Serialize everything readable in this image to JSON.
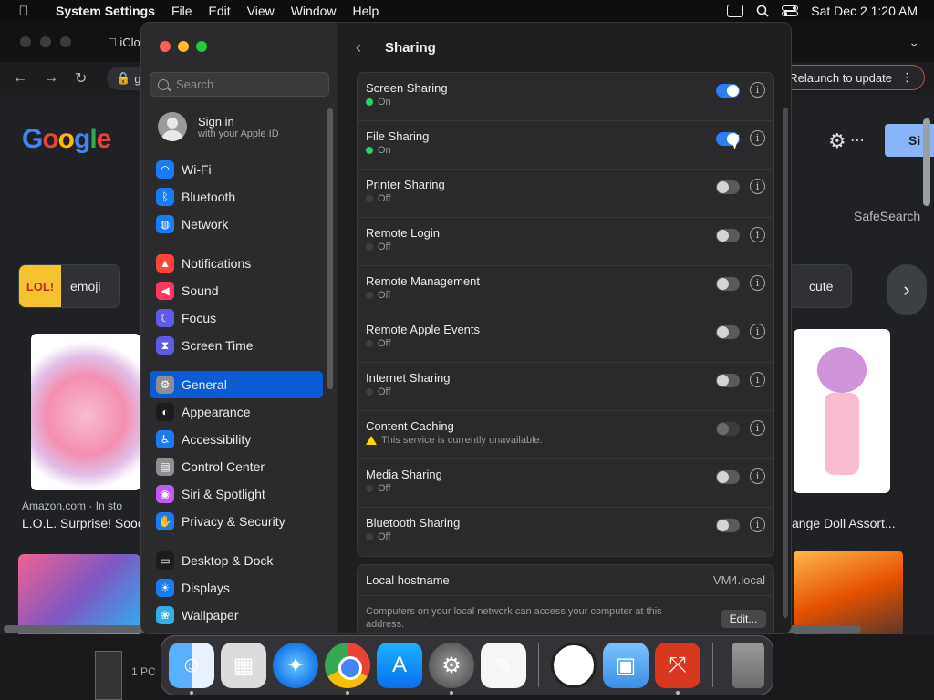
{
  "menubar": {
    "app_name": "System Settings",
    "menus": [
      "File",
      "Edit",
      "View",
      "Window",
      "Help"
    ],
    "datetime": "Sat Dec 2  1:20 AM"
  },
  "browser": {
    "tab_title": "iClou",
    "url_fragment": "g",
    "relaunch_label": "Relaunch to update",
    "logo": "Google",
    "signin": "Si",
    "safesearch": "SafeSearch",
    "chips": [
      "emoji",
      "cute"
    ],
    "chip_thumb": "LOL!",
    "result_source": "Amazon.com · In sto",
    "result_title": "L.O.L. Surprise! Sooo",
    "result_title_right": "ange Doll Assort...",
    "taskbar_label": "1 PC"
  },
  "settings": {
    "search_placeholder": "Search",
    "apple_id": {
      "title": "Sign in",
      "subtitle": "with your Apple ID"
    },
    "sidebar": [
      {
        "label": "Wi-Fi",
        "icon": "wifi-icon",
        "glyph": "◠",
        "color": "#1a7cf5"
      },
      {
        "label": "Bluetooth",
        "icon": "bluetooth-icon",
        "glyph": "ᛒ",
        "color": "#1a7cf5"
      },
      {
        "label": "Network",
        "icon": "globe-icon",
        "glyph": "◍",
        "color": "#1a7cf5"
      },
      {
        "label": "Notifications",
        "icon": "bell-icon",
        "glyph": "▲",
        "color": "#ff453a"
      },
      {
        "label": "Sound",
        "icon": "speaker-icon",
        "glyph": "◀",
        "color": "#ff375f"
      },
      {
        "label": "Focus",
        "icon": "moon-icon",
        "glyph": "☾",
        "color": "#5e5ce6"
      },
      {
        "label": "Screen Time",
        "icon": "hourglass-icon",
        "glyph": "⧗",
        "color": "#5e5ce6"
      },
      {
        "label": "General",
        "icon": "gear-icon",
        "glyph": "⚙",
        "color": "#8e8e93"
      },
      {
        "label": "Appearance",
        "icon": "appearance-icon",
        "glyph": "◐",
        "color": "#1c1c1e"
      },
      {
        "label": "Accessibility",
        "icon": "accessibility-icon",
        "glyph": "♿",
        "color": "#1a7cf5"
      },
      {
        "label": "Control Center",
        "icon": "control-center-icon",
        "glyph": "▤",
        "color": "#8e8e93"
      },
      {
        "label": "Siri & Spotlight",
        "icon": "siri-icon",
        "glyph": "◉",
        "color": "#bf5af2"
      },
      {
        "label": "Privacy & Security",
        "icon": "hand-icon",
        "glyph": "✋",
        "color": "#1a7cf5"
      },
      {
        "label": "Desktop & Dock",
        "icon": "dock-icon",
        "glyph": "▭",
        "color": "#1c1c1e"
      },
      {
        "label": "Displays",
        "icon": "display-icon",
        "glyph": "☀",
        "color": "#1a7cf5"
      },
      {
        "label": "Wallpaper",
        "icon": "wallpaper-icon",
        "glyph": "❀",
        "color": "#32ade6"
      }
    ],
    "active_item": "General",
    "pane_title": "Sharing",
    "services": [
      {
        "name": "Screen Sharing",
        "status": "On",
        "state": "on"
      },
      {
        "name": "File Sharing",
        "status": "On",
        "state": "on"
      },
      {
        "name": "Printer Sharing",
        "status": "Off",
        "state": "off"
      },
      {
        "name": "Remote Login",
        "status": "Off",
        "state": "off"
      },
      {
        "name": "Remote Management",
        "status": "Off",
        "state": "off"
      },
      {
        "name": "Remote Apple Events",
        "status": "Off",
        "state": "off"
      },
      {
        "name": "Internet Sharing",
        "status": "Off",
        "state": "off"
      },
      {
        "name": "Content Caching",
        "status": "This service is currently unavailable.",
        "state": "disabled"
      },
      {
        "name": "Media Sharing",
        "status": "Off",
        "state": "off"
      },
      {
        "name": "Bluetooth Sharing",
        "status": "Off",
        "state": "off"
      }
    ],
    "hostname_label": "Local hostname",
    "hostname_value": "VM4.local",
    "hostname_note": "Computers on your local network can access your computer at this address.",
    "edit_label": "Edit..."
  },
  "dock": [
    {
      "name": "finder-app",
      "cls": "finder",
      "glyph": "☺",
      "running": true
    },
    {
      "name": "launchpad-app",
      "cls": "launchpad",
      "glyph": "▦",
      "running": false
    },
    {
      "name": "safari-app",
      "cls": "safari",
      "glyph": "✦",
      "running": false
    },
    {
      "name": "chrome-app",
      "cls": "chrome",
      "glyph": "",
      "running": true
    },
    {
      "name": "app-store-app",
      "cls": "appstore",
      "glyph": "A",
      "running": false
    },
    {
      "name": "system-settings-app",
      "cls": "syssettings",
      "glyph": "⚙",
      "running": true
    },
    {
      "name": "textedit-app",
      "cls": "textedit",
      "glyph": "✎",
      "running": false
    },
    {
      "sep": true
    },
    {
      "name": "clock-app",
      "cls": "clock",
      "glyph": "◷",
      "running": false
    },
    {
      "name": "preview-app",
      "cls": "preview",
      "glyph": "▣",
      "running": false
    },
    {
      "name": "remote-desktop-app",
      "cls": "rdp",
      "glyph": "⤧",
      "running": true
    },
    {
      "sep": true
    },
    {
      "name": "trash-icon",
      "cls": "trash",
      "glyph": "",
      "running": false
    }
  ]
}
